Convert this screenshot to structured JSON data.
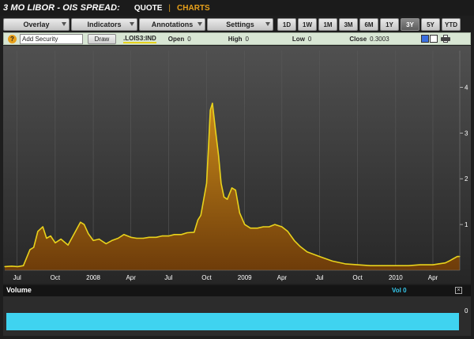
{
  "header": {
    "title": "3 MO LIBOR - OIS SPREAD:",
    "nav_quote": "QUOTE",
    "nav_separator": "|",
    "nav_charts": "CHARTS"
  },
  "toolbar": {
    "menus": [
      {
        "label": "Overlay"
      },
      {
        "label": "Indicators"
      },
      {
        "label": "Annotations"
      },
      {
        "label": "Settings"
      }
    ],
    "ranges": [
      "1D",
      "1W",
      "1M",
      "3M",
      "6M",
      "1Y",
      "3Y",
      "5Y",
      "YTD"
    ],
    "active_range": "3Y"
  },
  "security_bar": {
    "help_icon": "?",
    "input_value": "Add Security",
    "draw_label": "Draw",
    "ticker": ".LOIS3:IND",
    "open_label": "Open",
    "open_value": "0",
    "high_label": "High",
    "high_value": "0",
    "low_label": "Low",
    "low_value": "0",
    "close_label": "Close",
    "close_value": "0.3003",
    "swatch_colors": [
      "#3a6fe0",
      "#ffffff"
    ]
  },
  "volume": {
    "title": "Volume",
    "value_text": "Vol 0",
    "close_icon": "×",
    "tick": "0",
    "bar_color": "#3fd3f0"
  },
  "chart_data": {
    "type": "area",
    "series": [
      {
        "color": "#e8d21c",
        "x": [
          "2007-06-01",
          "2007-06-18",
          "2007-07-02",
          "2007-07-16",
          "2007-08-01",
          "2007-08-10",
          "2007-08-20",
          "2007-09-01",
          "2007-09-10",
          "2007-09-20",
          "2007-10-01",
          "2007-10-15",
          "2007-11-01",
          "2007-11-15",
          "2007-12-01",
          "2007-12-10",
          "2007-12-20",
          "2008-01-01",
          "2008-01-15",
          "2008-02-01",
          "2008-02-15",
          "2008-03-01",
          "2008-03-15",
          "2008-04-01",
          "2008-04-15",
          "2008-05-01",
          "2008-05-15",
          "2008-06-01",
          "2008-06-15",
          "2008-07-01",
          "2008-07-15",
          "2008-08-01",
          "2008-08-15",
          "2008-09-01",
          "2008-09-10",
          "2008-09-17",
          "2008-09-25",
          "2008-10-01",
          "2008-10-06",
          "2008-10-10",
          "2008-10-15",
          "2008-10-22",
          "2008-10-30",
          "2008-11-05",
          "2008-11-12",
          "2008-11-20",
          "2008-12-01",
          "2008-12-10",
          "2008-12-20",
          "2009-01-01",
          "2009-01-15",
          "2009-02-01",
          "2009-02-15",
          "2009-03-01",
          "2009-03-15",
          "2009-04-01",
          "2009-04-15",
          "2009-05-01",
          "2009-05-15",
          "2009-06-01",
          "2009-07-01",
          "2009-08-01",
          "2009-09-01",
          "2009-10-01",
          "2009-11-01",
          "2009-12-01",
          "2010-01-01",
          "2010-02-01",
          "2010-03-01",
          "2010-04-01",
          "2010-04-15",
          "2010-05-01",
          "2010-05-10",
          "2010-05-20",
          "2010-05-30",
          "2010-06-05"
        ],
        "y": [
          0.08,
          0.09,
          0.08,
          0.1,
          0.45,
          0.5,
          0.85,
          0.95,
          0.7,
          0.75,
          0.6,
          0.68,
          0.55,
          0.78,
          1.05,
          1.0,
          0.8,
          0.65,
          0.68,
          0.58,
          0.65,
          0.7,
          0.78,
          0.72,
          0.7,
          0.7,
          0.72,
          0.72,
          0.75,
          0.75,
          0.78,
          0.78,
          0.82,
          0.83,
          1.1,
          1.2,
          1.6,
          1.9,
          2.8,
          3.5,
          3.65,
          3.1,
          2.5,
          1.9,
          1.6,
          1.55,
          1.8,
          1.75,
          1.25,
          1.0,
          0.92,
          0.92,
          0.95,
          0.95,
          1.0,
          0.95,
          0.85,
          0.65,
          0.52,
          0.4,
          0.3,
          0.2,
          0.14,
          0.12,
          0.1,
          0.1,
          0.1,
          0.1,
          0.12,
          0.12,
          0.14,
          0.16,
          0.2,
          0.25,
          0.3,
          0.3
        ]
      }
    ],
    "x_ticks": [
      "Jul",
      "Oct",
      "2008",
      "Apr",
      "Jul",
      "Oct",
      "2009",
      "Apr",
      "Jul",
      "Oct",
      "2010",
      "Apr"
    ],
    "y_ticks": [
      "1",
      "2",
      "3",
      "4"
    ],
    "ylim": [
      0,
      4.8
    ],
    "xlim": [
      "2007-06-01",
      "2010-06-05"
    ],
    "grid": "vertical"
  }
}
